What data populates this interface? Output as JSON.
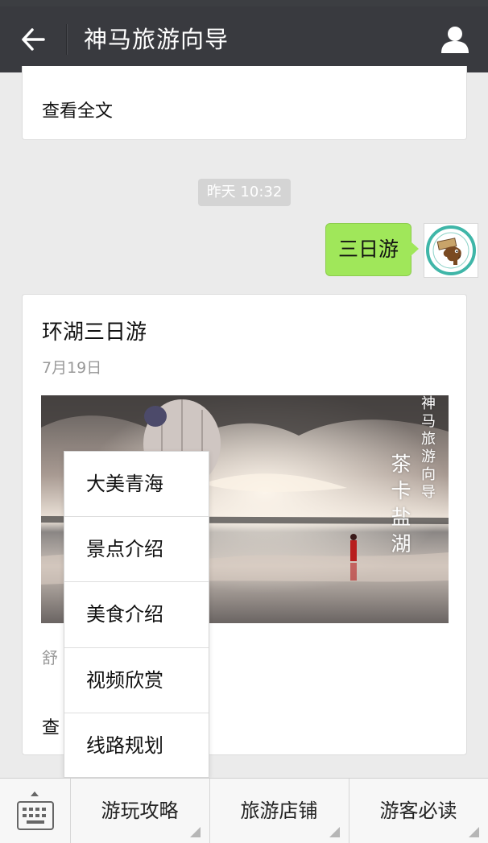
{
  "header": {
    "title": "神马旅游向导",
    "back_icon": "arrow-left-icon",
    "profile_icon": "person-icon"
  },
  "previous_card": {
    "read_full": "查看全文"
  },
  "timestamp": "昨天 10:32",
  "user_message": {
    "text": "三日游"
  },
  "article": {
    "title": "环湖三日游",
    "date": "7月19日",
    "cover_text_small": "神马旅游向导",
    "cover_text_large": "茶卡盐湖",
    "summary": "舒",
    "read_full": "查"
  },
  "popup_menu": {
    "items": [
      "大美青海",
      "景点介绍",
      "美食介绍",
      "视频欣赏",
      "线路规划"
    ]
  },
  "bottom_menu": {
    "keyboard_icon": "keyboard-icon",
    "items": [
      "游玩攻略",
      "旅游店铺",
      "游客必读"
    ]
  },
  "colors": {
    "titlebar": "#393a3f",
    "bubble": "#a0e75a",
    "background": "#ebebeb"
  }
}
